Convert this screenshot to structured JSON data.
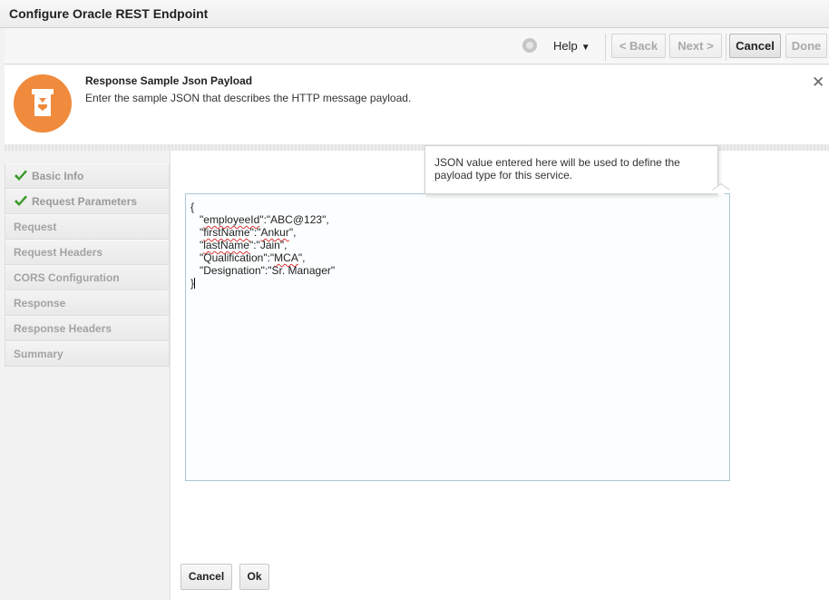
{
  "window": {
    "title": "Configure Oracle REST Endpoint"
  },
  "toolbar": {
    "help_label": "Help",
    "help_caret": "▼",
    "back_label": "< Back",
    "next_label": "Next >",
    "cancel_label": "Cancel",
    "done_label": "Done"
  },
  "header": {
    "step_title": "Response Sample Json Payload",
    "step_description": "Enter the sample JSON that describes the HTTP message payload.",
    "close_glyph": "✕",
    "badge_color": "#f08a3c"
  },
  "sidebar": {
    "items": [
      {
        "label": "Basic Info",
        "completed": true
      },
      {
        "label": "Request Parameters",
        "completed": true
      },
      {
        "label": "Request",
        "completed": false
      },
      {
        "label": "Request Headers",
        "completed": false
      },
      {
        "label": "CORS Configuration",
        "completed": false
      },
      {
        "label": "Response",
        "completed": false
      },
      {
        "label": "Response Headers",
        "completed": false
      },
      {
        "label": "Summary",
        "completed": false
      }
    ],
    "check_color": "#3a9a2a"
  },
  "editor": {
    "open_brace": "{",
    "close_brace": "}",
    "lines": [
      {
        "key": "employeeId",
        "value": "ABC@123",
        "comma": ","
      },
      {
        "key": "firstName",
        "value": "Ankur",
        "comma": ","
      },
      {
        "key": "lastName",
        "value": "Jain",
        "comma": ","
      },
      {
        "key": "Qualification",
        "value": "MCA",
        "comma": ","
      },
      {
        "key": "Designation",
        "value": "Sr. Manager",
        "comma": ""
      }
    ]
  },
  "tooltip": {
    "text": "JSON value entered here will be used to define the payload type for this service."
  },
  "form": {
    "cancel_label": "Cancel",
    "ok_label": "Ok"
  }
}
